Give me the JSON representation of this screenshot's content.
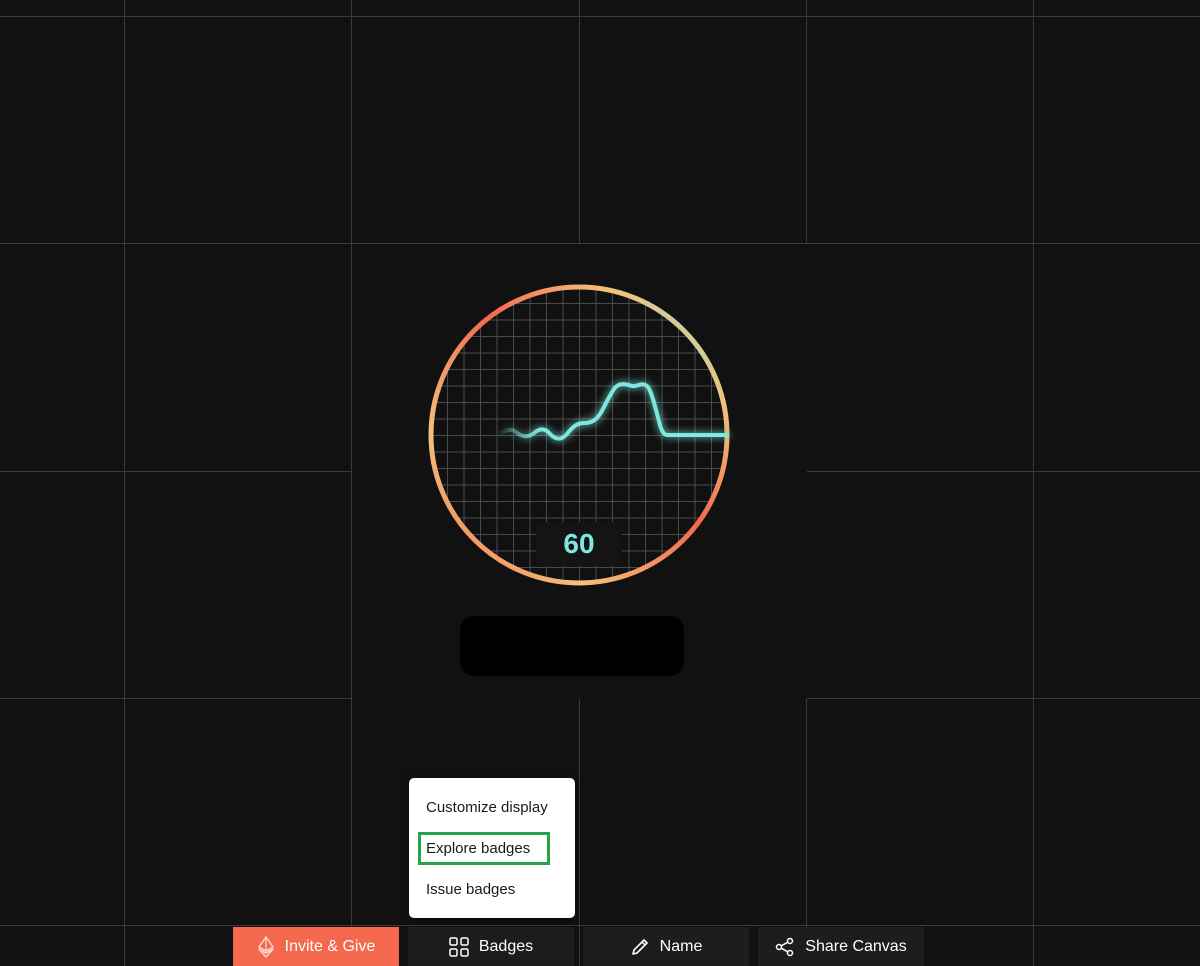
{
  "canvas": {
    "background_color": "#111111",
    "grid_color": "#3a3a3a"
  },
  "gauge": {
    "reading": "60",
    "reading_color": "#7ee8e0",
    "ring_colors": [
      "#f4684e",
      "#f2c27a",
      "#7ee8e0"
    ]
  },
  "menu": {
    "items": [
      {
        "label": "Customize display"
      },
      {
        "label": "Explore badges"
      },
      {
        "label": "Issue badges"
      }
    ],
    "highlight_color": "#27a349"
  },
  "toolbar": {
    "invite_label": "Invite & Give",
    "invite_icon": "ethereum-icon",
    "invite_color": "#f4684e",
    "badges_label": "Badges",
    "badges_icon": "grid-icon",
    "name_label": "Name",
    "name_icon": "pencil-icon",
    "share_label": "Share Canvas",
    "share_icon": "share-icon"
  }
}
